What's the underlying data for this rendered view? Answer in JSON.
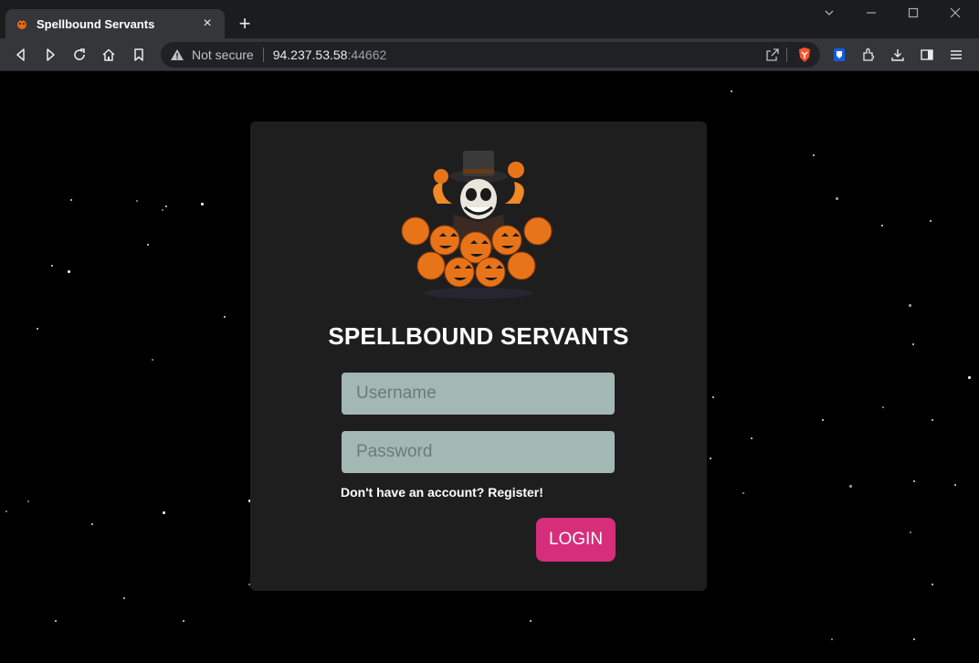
{
  "browser": {
    "tab_title": "Spellbound Servants",
    "new_tab_symbol": "+",
    "close_symbol": "×",
    "security_text": "Not secure",
    "url_host": "94.237.53.58",
    "url_port": ":44662",
    "icons": [
      "favicon-pumpkin-icon",
      "back-icon",
      "forward-icon",
      "reload-icon",
      "home-icon",
      "bookmark-icon",
      "warning-icon",
      "share-icon",
      "brave-shield-icon",
      "bitwarden-icon",
      "extensions-icon",
      "download-icon",
      "sidebar-icon",
      "menu-icon"
    ]
  },
  "login": {
    "title": "SPELLBOUND SERVANTS",
    "username_placeholder": "Username",
    "password_placeholder": "Password",
    "register_text": "Don't have an account? Register!",
    "login_label": "LOGIN"
  },
  "colors": {
    "card_bg": "#1f1e1e",
    "input_bg": "#a3b7b3",
    "button_bg": "#d62e7a",
    "page_bg": "#000000"
  }
}
